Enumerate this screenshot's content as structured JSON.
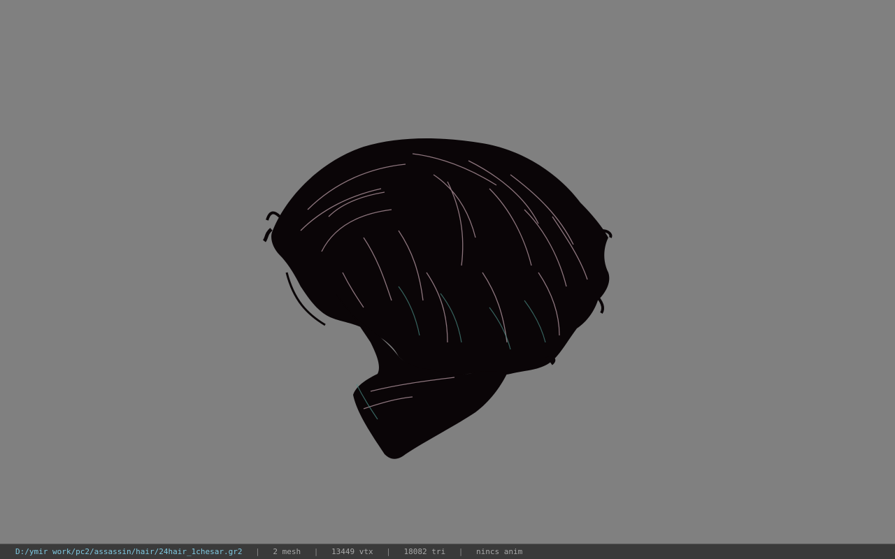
{
  "viewer": {
    "background_color": "#808080",
    "model_colors": {
      "base": "#0a0507",
      "highlight_pink": "#b89aa4",
      "highlight_teal": "#4a8c84"
    }
  },
  "status_bar": {
    "file_path": "D:/ymir work/pc2/assassin/hair/24hair_1chesar.gr2",
    "separator": "|",
    "mesh_count": "2 mesh",
    "vertex_count": "13449 vtx",
    "triangle_count": "18082 tri",
    "anim_status": "nincs anim",
    "path_color": "#7fc8e0",
    "text_color": "#a8a8a8"
  }
}
